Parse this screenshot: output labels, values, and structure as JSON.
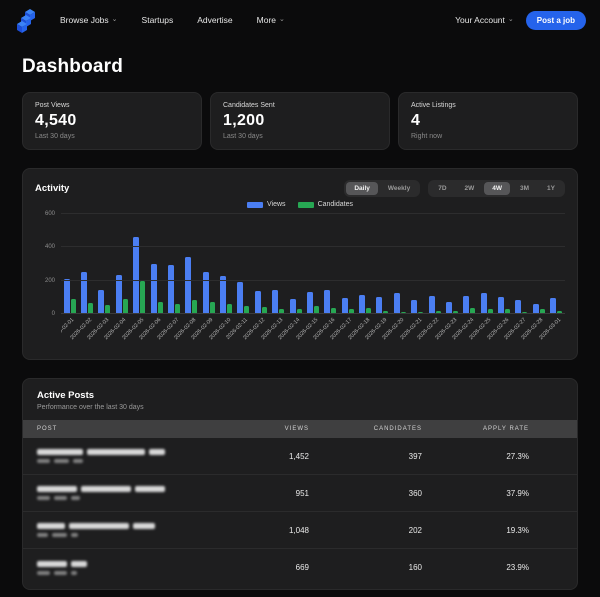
{
  "nav": {
    "items": [
      {
        "label": "Browse Jobs",
        "chevron": true
      },
      {
        "label": "Startups",
        "chevron": false
      },
      {
        "label": "Advertise",
        "chevron": false
      },
      {
        "label": "More",
        "chevron": true
      }
    ],
    "account_label": "Your Account",
    "post_job_label": "Post a job"
  },
  "page_title": "Dashboard",
  "stats": [
    {
      "label": "Post Views",
      "value": "4,540",
      "caption": "Last 30 days"
    },
    {
      "label": "Candidates Sent",
      "value": "1,200",
      "caption": "Last 30 days"
    },
    {
      "label": "Active Listings",
      "value": "4",
      "caption": "Right now"
    }
  ],
  "activity": {
    "title": "Activity",
    "granularity_options": [
      "Daily",
      "Weekly"
    ],
    "granularity_selected": "Daily",
    "range_options": [
      "7D",
      "2W",
      "4W",
      "3M",
      "1Y"
    ],
    "range_selected": "4W"
  },
  "chart_data": {
    "type": "bar",
    "title": "Activity",
    "categories": [
      "2026-02-01",
      "2026-02-02",
      "2026-02-03",
      "2026-02-04",
      "2026-02-05",
      "2026-02-06",
      "2026-02-07",
      "2026-02-08",
      "2026-02-09",
      "2026-02-10",
      "2026-02-11",
      "2026-02-12",
      "2026-02-13",
      "2026-02-14",
      "2026-02-15",
      "2026-02-16",
      "2026-02-17",
      "2026-02-18",
      "2026-02-19",
      "2026-02-20",
      "2026-02-21",
      "2026-02-22",
      "2026-02-23",
      "2026-02-24",
      "2026-02-25",
      "2026-02-26",
      "2026-02-27",
      "2026-02-28",
      "2026-03-01"
    ],
    "series": [
      {
        "name": "Views",
        "color": "#4b7ef2",
        "values": [
          210,
          255,
          145,
          235,
          460,
          300,
          295,
          345,
          255,
          230,
          190,
          140,
          145,
          90,
          130,
          145,
          95,
          115,
          105,
          125,
          85,
          110,
          70,
          110,
          125,
          100,
          85,
          60,
          95
        ]
      },
      {
        "name": "Candidates",
        "color": "#27a753",
        "values": [
          90,
          65,
          55,
          90,
          200,
          75,
          60,
          85,
          75,
          60,
          50,
          40,
          30,
          30,
          48,
          38,
          28,
          38,
          18,
          12,
          10,
          20,
          18,
          38,
          32,
          33,
          10,
          28,
          18
        ]
      }
    ],
    "ylim": [
      0,
      600
    ],
    "yticks": [
      0,
      200,
      400,
      600
    ],
    "grid": true,
    "legend_position": "top-center"
  },
  "active_posts": {
    "title": "Active Posts",
    "subtitle": "Performance over the last 30 days",
    "columns": [
      "POST",
      "VIEWS",
      "CANDIDATES",
      "APPLY RATE"
    ],
    "rows": [
      {
        "post": "[redacted]",
        "views": "1,452",
        "candidates": "397",
        "apply_rate": "27.3%"
      },
      {
        "post": "[redacted]",
        "views": "951",
        "candidates": "360",
        "apply_rate": "37.9%"
      },
      {
        "post": "[redacted]",
        "views": "1,048",
        "candidates": "202",
        "apply_rate": "19.3%"
      },
      {
        "post": "[redacted]",
        "views": "669",
        "candidates": "160",
        "apply_rate": "23.9%"
      }
    ]
  },
  "colors": {
    "accent_blue": "#2563eb",
    "bar_blue": "#4b7ef2",
    "bar_green": "#27a753",
    "panel_bg": "#1e1e1f",
    "page_bg": "#0b0b0c"
  }
}
